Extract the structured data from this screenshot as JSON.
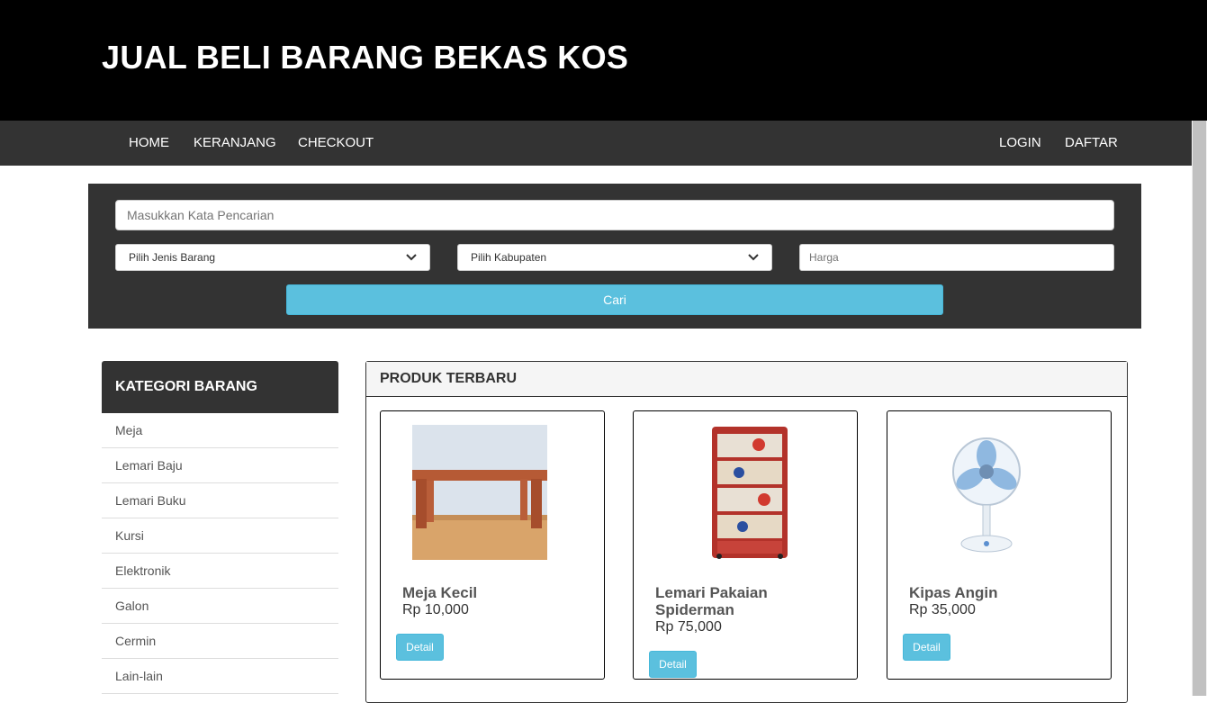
{
  "header": {
    "title": "JUAL BELI BARANG BEKAS KOS"
  },
  "nav": {
    "left": [
      "HOME",
      "KERANJANG",
      "CHECKOUT"
    ],
    "right": [
      "LOGIN",
      "DAFTAR"
    ]
  },
  "search": {
    "placeholder": "Masukkan Kata Pencarian",
    "jenis_selected": "Pilih Jenis Barang",
    "kabupaten_selected": "Pilih Kabupaten",
    "harga_placeholder": "Harga",
    "button_label": "Cari"
  },
  "kategori": {
    "title": "KATEGORI BARANG",
    "items": [
      "Meja",
      "Lemari Baju",
      "Lemari Buku",
      "Kursi",
      "Elektronik",
      "Galon",
      "Cermin",
      "Lain-lain"
    ]
  },
  "produk": {
    "title": "PRODUK TERBARU",
    "items": [
      {
        "name": "Meja Kecil",
        "price": "Rp 10,000",
        "button": "Detail",
        "image_icon": "table-photo"
      },
      {
        "name": "Lemari Pakaian Spiderman",
        "price": "Rp 75,000",
        "button": "Detail",
        "image_icon": "drawer-cabinet-photo"
      },
      {
        "name": "Kipas Angin",
        "price": "Rp 35,000",
        "button": "Detail",
        "image_icon": "fan-photo"
      }
    ]
  },
  "colors": {
    "header_bg": "#000000",
    "nav_bg": "#333333",
    "accent": "#5bc0de"
  }
}
